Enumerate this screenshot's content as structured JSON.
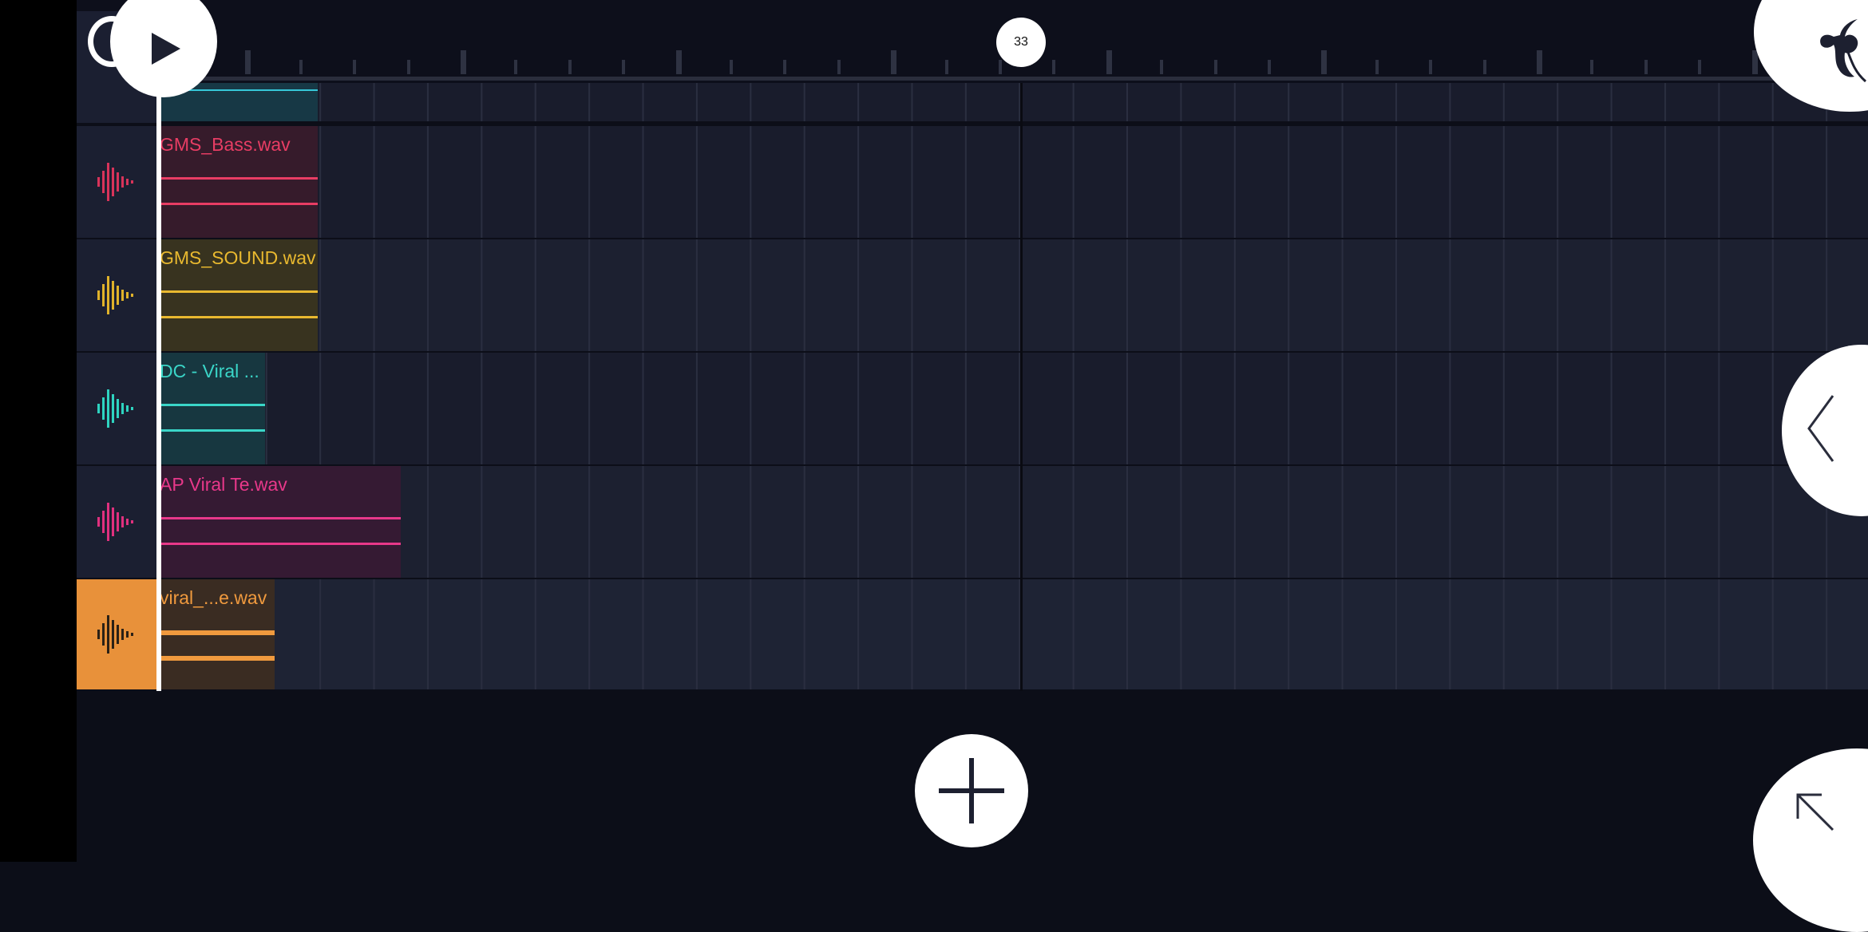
{
  "transport": {
    "play_icon": "play-icon",
    "loop_icon": "loop-icon",
    "bar_marker": "33"
  },
  "app": {
    "logo_icon": "fl-fruit-icon"
  },
  "tracks": [
    {
      "clip_name": "",
      "color": "#1f7f8f",
      "clip_color": "#173845",
      "text_color": "#36c7d8",
      "active": false
    },
    {
      "clip_name": "GMS_Bass.wav",
      "color": "#d8335a",
      "clip_color": "#361b2b",
      "text_color": "#e83d64",
      "active": false
    },
    {
      "clip_name": "GMS_SOUND.wav",
      "color": "#e0b22a",
      "clip_color": "#38331f",
      "text_color": "#e9b92f",
      "active": false
    },
    {
      "clip_name": "DC - Viral ...",
      "color": "#2ed3c0",
      "clip_color": "#173740",
      "text_color": "#3ad6c8",
      "active": false
    },
    {
      "clip_name": "AP Viral Te.wav",
      "color": "#e0307e",
      "clip_color": "#351a33",
      "text_color": "#e8388a",
      "active": false
    },
    {
      "clip_name": "viral_...e.wav",
      "color": "#e8913a",
      "clip_color": "#3a2c22",
      "text_color": "#f09a3e",
      "active": true
    }
  ],
  "controls": {
    "side_icon": "chevron-left-icon",
    "add_icon": "plus-icon",
    "corner_icon": "arrow-up-left-icon"
  }
}
